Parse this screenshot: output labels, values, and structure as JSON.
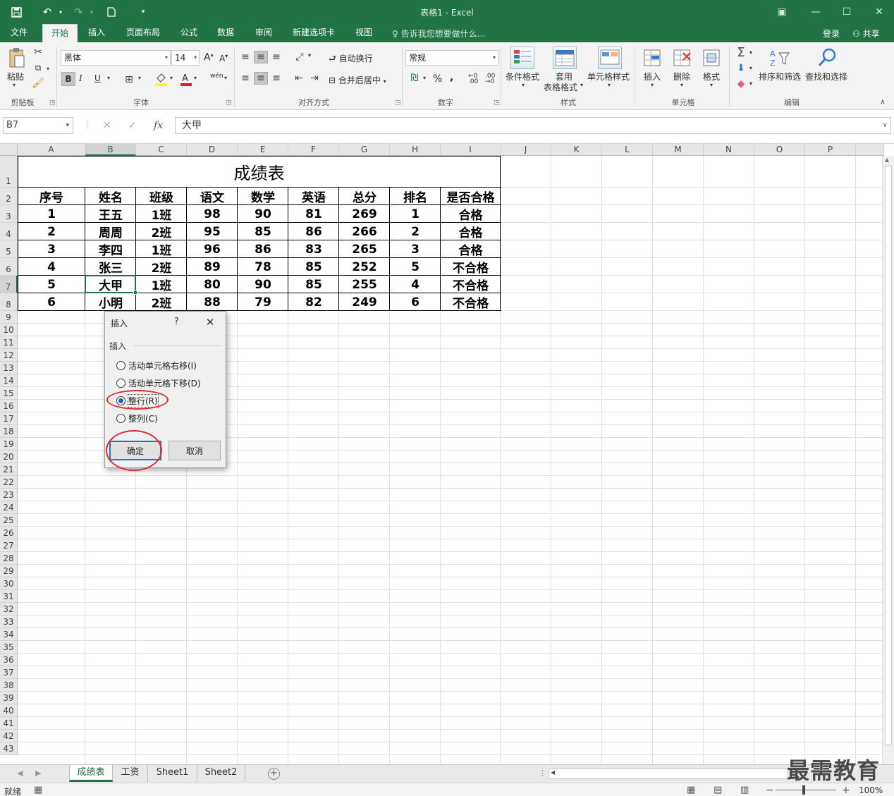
{
  "window": {
    "title": "表格1 - Excel",
    "qat_icons": [
      "save-icon",
      "undo-icon",
      "redo-icon",
      "new-doc-icon",
      "customize-qat-icon"
    ]
  },
  "tabs": [
    {
      "label": "文件",
      "active": false
    },
    {
      "label": "开始",
      "active": true
    },
    {
      "label": "插入",
      "active": false
    },
    {
      "label": "页面布局",
      "active": false
    },
    {
      "label": "公式",
      "active": false
    },
    {
      "label": "数据",
      "active": false
    },
    {
      "label": "审阅",
      "active": false
    },
    {
      "label": "新建选项卡",
      "active": false
    },
    {
      "label": "视图",
      "active": false
    }
  ],
  "tell_me": "告诉我您想要做什么...",
  "account": {
    "login": "登录",
    "share": "共享"
  },
  "ribbon": {
    "clipboard": {
      "paste": "粘贴",
      "label": "剪贴板"
    },
    "font": {
      "name": "黑体",
      "size": "14",
      "bold": "B",
      "italic": "I",
      "underline": "U",
      "label": "字体",
      "grow": "A",
      "shrink": "A",
      "phonetic": "wén"
    },
    "alignment": {
      "wrap": "自动换行",
      "merge": "合并后居中",
      "label": "对齐方式"
    },
    "number": {
      "format": "常规",
      "percent": "%",
      "comma": ",",
      "label": "数字"
    },
    "styles": {
      "conditional": "条件格式",
      "table_line1": "套用",
      "table_line2": "表格格式",
      "cell_styles": "单元格样式",
      "label": "样式"
    },
    "cells": {
      "insert": "插入",
      "delete": "删除",
      "format": "格式",
      "label": "单元格"
    },
    "editing": {
      "sort": "排序和筛选",
      "find": "查找和选择",
      "label": "编辑"
    }
  },
  "formula_bar": {
    "name_box": "B7",
    "cancel": "✕",
    "enter": "✓",
    "fx": "fx",
    "value": "大甲"
  },
  "columns": [
    "A",
    "B",
    "C",
    "D",
    "E",
    "F",
    "G",
    "H",
    "I",
    "J",
    "K",
    "L",
    "M",
    "N",
    "O",
    "P"
  ],
  "selected_column": "B",
  "selected_row": 7,
  "rows": [
    "1",
    "2",
    "3",
    "4",
    "5",
    "6",
    "7",
    "8",
    "9",
    "10",
    "11",
    "12",
    "13",
    "14",
    "15",
    "16",
    "17",
    "18",
    "19",
    "20",
    "21",
    "22",
    "23",
    "24",
    "25",
    "26",
    "27",
    "28",
    "29",
    "30",
    "31",
    "32",
    "33",
    "34",
    "35",
    "36",
    "37",
    "38",
    "39",
    "40",
    "41",
    "42",
    "43"
  ],
  "sheet": {
    "title": "成绩表",
    "headers": [
      "序号",
      "姓名",
      "班级",
      "语文",
      "数学",
      "英语",
      "总分",
      "排名",
      "是否合格"
    ],
    "rows": [
      [
        "1",
        "王五",
        "1班",
        "98",
        "90",
        "81",
        "269",
        "1",
        "合格"
      ],
      [
        "2",
        "周周",
        "2班",
        "95",
        "85",
        "86",
        "266",
        "2",
        "合格"
      ],
      [
        "3",
        "李四",
        "1班",
        "96",
        "86",
        "83",
        "265",
        "3",
        "合格"
      ],
      [
        "4",
        "张三",
        "2班",
        "89",
        "78",
        "85",
        "252",
        "5",
        "不合格"
      ],
      [
        "5",
        "大甲",
        "1班",
        "80",
        "90",
        "85",
        "255",
        "4",
        "不合格"
      ],
      [
        "6",
        "小明",
        "2班",
        "88",
        "79",
        "82",
        "249",
        "6",
        "不合格"
      ]
    ]
  },
  "dialog": {
    "title": "插入",
    "help": "?",
    "section": "插入",
    "options": [
      {
        "label": "活动单元格右移(I)",
        "checked": false
      },
      {
        "label": "活动单元格下移(D)",
        "checked": false
      },
      {
        "label": "整行(R)",
        "checked": true
      },
      {
        "label": "整列(C)",
        "checked": false
      }
    ],
    "ok": "确定",
    "cancel": "取消"
  },
  "sheet_tabs": [
    {
      "label": "成绩表",
      "active": true
    },
    {
      "label": "工资",
      "active": false
    },
    {
      "label": "Sheet1",
      "active": false
    },
    {
      "label": "Sheet2",
      "active": false
    }
  ],
  "add_sheet": "+",
  "watermark": "最需教育",
  "status": {
    "ready": "就绪",
    "zoom": "100%",
    "zoom_minus": "−",
    "zoom_plus": "+"
  },
  "colors": {
    "accent": "#217346",
    "annotation": "#e0292b",
    "radio": "#1c5fb5"
  }
}
